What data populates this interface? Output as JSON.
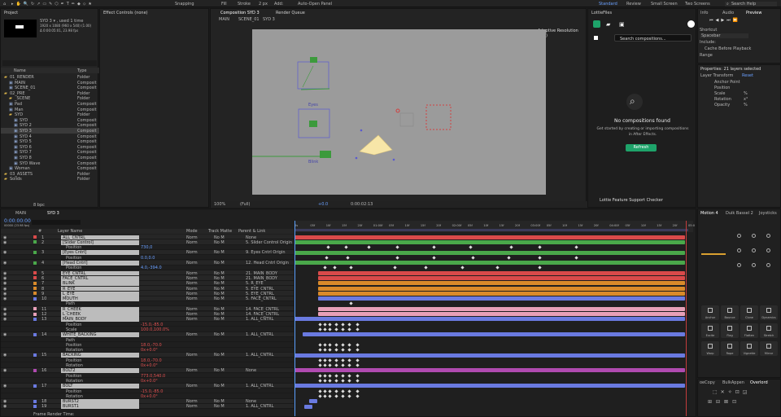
{
  "toolbar": {
    "tools": "Snapping",
    "fill": "Fill",
    "stroke": "Stroke",
    "px": "2 px",
    "add": "Add:",
    "auto_open": "Auto-Open Panel",
    "workspaces": [
      "Standard",
      "Review",
      "Small Screen",
      "Two Screens"
    ],
    "search": "Search Help"
  },
  "project": {
    "title": "Project",
    "info": [
      "SYD 3 ▾ , used 1 time",
      "1920 x 1080 (960 x 540) (1.00)",
      "Δ 0:00:05:01, 23.98 fps"
    ],
    "search_placeholder": "",
    "cols": [
      "Name",
      "Type"
    ],
    "items": [
      {
        "n": "01_RENDER",
        "t": "Folder",
        "ind": 0
      },
      {
        "n": "MAIN",
        "t": "Composit",
        "ind": 1
      },
      {
        "n": "SCENE_01",
        "t": "Composit",
        "ind": 1
      },
      {
        "n": "02_PRE",
        "t": "Folder",
        "ind": 0
      },
      {
        "n": "_SCENE",
        "t": "Folder",
        "ind": 1
      },
      {
        "n": "Pad",
        "t": "Composit",
        "ind": 1
      },
      {
        "n": "Man",
        "t": "Composit",
        "ind": 1
      },
      {
        "n": "SYD",
        "t": "Folder",
        "ind": 1
      },
      {
        "n": "SYD",
        "t": "Composit",
        "ind": 2
      },
      {
        "n": "SYD 2",
        "t": "Composit",
        "ind": 2
      },
      {
        "n": "SYD 3",
        "t": "Composit",
        "ind": 2,
        "sel": true
      },
      {
        "n": "SYD 4",
        "t": "Composit",
        "ind": 2
      },
      {
        "n": "SYD 5",
        "t": "Composit",
        "ind": 2
      },
      {
        "n": "SYD 6",
        "t": "Composit",
        "ind": 2
      },
      {
        "n": "SYD 7",
        "t": "Composit",
        "ind": 2
      },
      {
        "n": "SYD 8",
        "t": "Composit",
        "ind": 2
      },
      {
        "n": "SYD Wave",
        "t": "Composit",
        "ind": 2
      },
      {
        "n": "Woman",
        "t": "Composit",
        "ind": 1
      },
      {
        "n": "03_ASSETS",
        "t": "Folder",
        "ind": 0
      },
      {
        "n": "Solids",
        "t": "Folder",
        "ind": 0
      }
    ],
    "bpc": "8 bpc"
  },
  "effects": {
    "title": "Effect Controls (none)"
  },
  "comp": {
    "tab": "Composition SYD 3",
    "render_queue": "Render Queue",
    "breadcrumbs": [
      "MAIN",
      "SCENE_01",
      "SYD 3"
    ],
    "adaptive": "Adaptive Resolution (1/1)",
    "labels": {
      "eyes": "Eyes",
      "blink": "Blink"
    },
    "zoom": "100%",
    "quality": "(Full)",
    "timecode": "0:00:02:13",
    "exposure": "+0.0"
  },
  "lottie": {
    "title": "LottieFiles",
    "search_placeholder": "Search compositions...",
    "empty_title": "No compositions found",
    "empty_desc": "Get started by creating or importing compositions in After Effects.",
    "refresh": "Refresh",
    "checker": "Lottie Feature Support Checker"
  },
  "preview": {
    "tabs": [
      "Info",
      "Audio",
      "Preview"
    ],
    "shortcut_label": "Shortcut",
    "shortcut_value": "Spacebar",
    "include": "Include:",
    "cache": "Cache Before Playback",
    "range": "Range",
    "props_header": "Properties: 21 layers selected",
    "transform": "Layer Transform",
    "reset": "Reset",
    "props": [
      "Anchor Point",
      "Position",
      "Scale",
      "Rotation",
      "Opacity"
    ],
    "scale_val": "%",
    "rot_val": "x°",
    "op_val": "%"
  },
  "timeline": {
    "tabs": [
      "MAIN",
      "SYD 3"
    ],
    "timecode": "0:00:00:00",
    "fps": "00000 (23.98 fps)",
    "cols": [
      "#",
      "Layer Name",
      "Mode",
      "Track Matte",
      "Parent & Link"
    ],
    "ticks": [
      "0s",
      "05f",
      "10f",
      "15f",
      "20f",
      "01:00f",
      "05f",
      "10f",
      "15f",
      "20f",
      "02:00f",
      "05f",
      "10f",
      "15f",
      "20f",
      "03:00f",
      "05f",
      "10f",
      "15f",
      "20f",
      "04:00f",
      "05f",
      "10f",
      "15f",
      "20f",
      "05:0"
    ],
    "layers": [
      {
        "id": "1",
        "name": "ALL_CNTRL",
        "mode": "Norm",
        "matte": "No M",
        "parent": "None",
        "color": "#d94a4a",
        "c": "#d94a4a"
      },
      {
        "id": "2",
        "name": "[Slider Control]",
        "mode": "Norm",
        "matte": "No M",
        "parent": "5. Slider Control Origin",
        "color": "#4aa84a",
        "c": "#4aa84a"
      },
      {
        "id": "",
        "name": "Position",
        "mode": "",
        "matte": "",
        "parent": "",
        "color": "",
        "val": "730,0",
        "sub": true
      },
      {
        "id": "3",
        "name": "[Eyes Cntrl]",
        "mode": "Norm",
        "matte": "No M",
        "parent": "9. Eyes Cntrl Origin",
        "color": "#4aa84a",
        "c": "#4aa84a"
      },
      {
        "id": "",
        "name": "Position",
        "mode": "",
        "matte": "",
        "parent": "",
        "color": "",
        "val": "0.0,0.0",
        "sub": true
      },
      {
        "id": "4",
        "name": "[Head Cntrl]",
        "mode": "Norm",
        "matte": "No M",
        "parent": "12. Head Cntrl Origin",
        "color": "#4aa84a",
        "c": "#4aa84a"
      },
      {
        "id": "",
        "name": "Position",
        "mode": "",
        "matte": "",
        "parent": "",
        "color": "",
        "val": "4.0,-394.0",
        "sub": true
      },
      {
        "id": "5",
        "name": "EYE_CNTRL",
        "mode": "Norm",
        "matte": "No M",
        "parent": "21. MAIN_BODY",
        "color": "#d94a4a",
        "c": "#d94a4a"
      },
      {
        "id": "6",
        "name": "FACE_CNTRL",
        "mode": "Norm",
        "matte": "No M",
        "parent": "21. MAIN_BODY",
        "color": "#d94a4a",
        "c": "#d94a4a"
      },
      {
        "id": "7",
        "name": "BLINK",
        "mode": "Norm",
        "matte": "No M",
        "parent": "5. R_EYE",
        "color": "#d98a2a",
        "c": "#d98a2a"
      },
      {
        "id": "8",
        "name": "R_EYE",
        "mode": "Norm",
        "matte": "No M",
        "parent": "5. EYE_CNTRL",
        "color": "#d98a2a",
        "c": "#d98a2a"
      },
      {
        "id": "9",
        "name": "L_EYE",
        "mode": "Norm",
        "matte": "No M",
        "parent": "5. EYE_CNTRL",
        "color": "#d98a2a",
        "c": "#d98a2a"
      },
      {
        "id": "10",
        "name": "MOUTH",
        "mode": "Norm",
        "matte": "No M",
        "parent": "5. FACE_CNTRL",
        "color": "#6a7ae0",
        "c": "#6a7ae0"
      },
      {
        "id": "",
        "name": "Path",
        "mode": "",
        "matte": "",
        "parent": "",
        "color": "",
        "val": "",
        "sub": true
      },
      {
        "id": "11",
        "name": "R_CHEEK",
        "mode": "Norm",
        "matte": "No M",
        "parent": "14. FACE_CNTRL",
        "color": "#e8a0b8",
        "c": "#e8a0b8"
      },
      {
        "id": "12",
        "name": "L_CHEEK",
        "mode": "Norm",
        "matte": "No M",
        "parent": "14. FACE_CNTRL",
        "color": "#e8a0b8",
        "c": "#e8a0b8"
      },
      {
        "id": "13",
        "name": "MAIN_BODY",
        "mode": "Norm",
        "matte": "No M",
        "parent": "1. ALL_CNTRL",
        "color": "#6a7ae0",
        "c": "#6a7ae0"
      },
      {
        "id": "",
        "name": "Position",
        "mode": "",
        "matte": "",
        "parent": "",
        "color": "",
        "val": "-15.0,-85.0",
        "sub": true,
        "red": true
      },
      {
        "id": "",
        "name": "Scale",
        "mode": "",
        "matte": "",
        "parent": "",
        "color": "",
        "val": "100.0,100.0%",
        "sub": true,
        "red": true
      },
      {
        "id": "14",
        "name": "WHITE_BACKING",
        "mode": "Norm",
        "matte": "No M",
        "parent": "1. ALL_CNTRL",
        "color": "#6a7ae0",
        "c": "#6a7ae0"
      },
      {
        "id": "",
        "name": "Path",
        "mode": "",
        "matte": "",
        "parent": "",
        "color": "",
        "val": "",
        "sub": true
      },
      {
        "id": "",
        "name": "Position",
        "mode": "",
        "matte": "",
        "parent": "",
        "color": "",
        "val": "18.0,-70.0",
        "sub": true,
        "red": true
      },
      {
        "id": "",
        "name": "Rotation",
        "mode": "",
        "matte": "",
        "parent": "",
        "color": "",
        "val": "0x+0.0°",
        "sub": true,
        "red": true
      },
      {
        "id": "15",
        "name": "BACKING",
        "mode": "Norm",
        "matte": "No M",
        "parent": "1. ALL_CNTRL",
        "color": "#6a7ae0",
        "c": "#6a7ae0"
      },
      {
        "id": "",
        "name": "Position",
        "mode": "",
        "matte": "",
        "parent": "",
        "color": "",
        "val": "18.0,-70.0",
        "sub": true,
        "red": true
      },
      {
        "id": "",
        "name": "Rotation",
        "mode": "",
        "matte": "",
        "parent": "",
        "color": "",
        "val": "0x+0.0°",
        "sub": true,
        "red": true
      },
      {
        "id": "16",
        "name": "BOLT2",
        "mode": "Norm",
        "matte": "No M",
        "parent": "None",
        "color": "#b04ab0",
        "c": "#b04ab0"
      },
      {
        "id": "",
        "name": "Position",
        "mode": "",
        "matte": "",
        "parent": "",
        "color": "",
        "val": "773.0,540.0",
        "sub": true,
        "red": true
      },
      {
        "id": "",
        "name": "Rotation",
        "mode": "",
        "matte": "",
        "parent": "",
        "color": "",
        "val": "0x+0.0°",
        "sub": true,
        "red": true
      },
      {
        "id": "17",
        "name": "BOLT",
        "mode": "Norm",
        "matte": "No M",
        "parent": "1. ALL_CNTRL",
        "color": "#6a7ae0",
        "c": "#6a7ae0"
      },
      {
        "id": "",
        "name": "Position",
        "mode": "",
        "matte": "",
        "parent": "",
        "color": "",
        "val": "-15.0,-85.0",
        "sub": true,
        "red": true
      },
      {
        "id": "",
        "name": "Rotation",
        "mode": "",
        "matte": "",
        "parent": "",
        "color": "",
        "val": "0x+0.0°",
        "sub": true,
        "red": true
      },
      {
        "id": "18",
        "name": "BURST2",
        "mode": "Norm",
        "matte": "No M",
        "parent": "None",
        "color": "#6a7ae0",
        "c": "#6a7ae0"
      },
      {
        "id": "19",
        "name": "BURST1",
        "mode": "Norm",
        "matte": "No M",
        "parent": "1. ALL_CNTRL",
        "color": "#6a7ae0",
        "c": "#6a7ae0"
      }
    ],
    "footer": "Frame Render Time:"
  },
  "motion": {
    "tabs": [
      "Motion 4",
      "Duik Bassel 2",
      "Joysticks"
    ],
    "tiles": [
      "Anchor",
      "Bounce",
      "Clone",
      "Dynamics",
      "Excite",
      "Flag",
      "Flatten",
      "Stretch",
      "Warp",
      "Rope",
      "Vignette",
      "Mirror"
    ],
    "footer_tabs": [
      "oeCopy",
      "BulkAppen",
      "Overlord"
    ]
  }
}
